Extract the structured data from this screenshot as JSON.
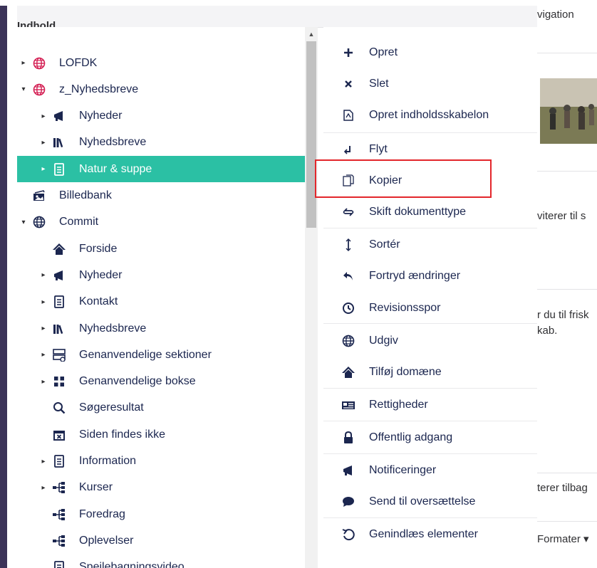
{
  "tree": {
    "header": "Indhold",
    "items": [
      {
        "label": "LOFDK",
        "icon": "globe-icon",
        "caret": "collapsed",
        "indent": 0
      },
      {
        "label": "z_Nyhedsbreve",
        "icon": "globe-icon",
        "caret": "expanded",
        "indent": 0
      },
      {
        "label": "Nyheder",
        "icon": "megaphone-icon",
        "caret": "collapsed",
        "indent": 1
      },
      {
        "label": "Nyhedsbreve",
        "icon": "library-icon",
        "caret": "collapsed",
        "indent": 1
      },
      {
        "label": "Natur & suppe",
        "icon": "document-icon",
        "caret": "collapsed",
        "indent": 1,
        "active": true
      },
      {
        "label": "Billedbank",
        "icon": "pictures-icon",
        "caret": "none",
        "indent": 0
      },
      {
        "label": "Commit",
        "icon": "globe-icon",
        "caret": "expanded",
        "indent": 0
      },
      {
        "label": "Forside",
        "icon": "home-icon",
        "caret": "none",
        "indent": 1
      },
      {
        "label": "Nyheder",
        "icon": "megaphone-icon",
        "caret": "collapsed",
        "indent": 1
      },
      {
        "label": "Kontakt",
        "icon": "document-icon",
        "caret": "collapsed",
        "indent": 1
      },
      {
        "label": "Nyhedsbreve",
        "icon": "library-icon",
        "caret": "collapsed",
        "indent": 1
      },
      {
        "label": "Genanvendelige sektioner",
        "icon": "sections-icon",
        "caret": "collapsed",
        "indent": 1
      },
      {
        "label": "Genanvendelige bokse",
        "icon": "grid-icon",
        "caret": "collapsed",
        "indent": 1
      },
      {
        "label": "Søgeresultat",
        "icon": "search-icon",
        "caret": "none",
        "indent": 1
      },
      {
        "label": "Siden findes ikke",
        "icon": "calendar-x-icon",
        "caret": "none",
        "indent": 1
      },
      {
        "label": "Information",
        "icon": "document-icon",
        "caret": "collapsed",
        "indent": 1
      },
      {
        "label": "Kurser",
        "icon": "sitemap-icon",
        "caret": "collapsed",
        "indent": 1
      },
      {
        "label": "Foredrag",
        "icon": "sitemap-icon",
        "caret": "none",
        "indent": 1
      },
      {
        "label": "Oplevelser",
        "icon": "sitemap-icon",
        "caret": "none",
        "indent": 1
      },
      {
        "label": "Spejlebagningsvideo",
        "icon": "document-icon",
        "caret": "none",
        "indent": 1
      }
    ]
  },
  "menu": {
    "items": [
      {
        "label": "Opret",
        "icon": "plus-icon"
      },
      {
        "label": "Slet",
        "icon": "delete-icon"
      },
      {
        "label": "Opret indholdsskabelon",
        "icon": "blueprint-icon"
      },
      {
        "label": "Flyt",
        "icon": "move-icon"
      },
      {
        "label": "Kopier",
        "icon": "copy-icon"
      },
      {
        "label": "Skift dokumenttype",
        "icon": "swap-icon"
      },
      {
        "label": "Sortér",
        "icon": "sort-icon"
      },
      {
        "label": "Fortryd ændringer",
        "icon": "undo-icon"
      },
      {
        "label": "Revisionsspor",
        "icon": "history-icon"
      },
      {
        "label": "Udgiv",
        "icon": "globe-icon"
      },
      {
        "label": "Tilføj domæne",
        "icon": "home-icon"
      },
      {
        "label": "Rettigheder",
        "icon": "permissions-icon"
      },
      {
        "label": "Offentlig adgang",
        "icon": "lock-icon"
      },
      {
        "label": "Notificeringer",
        "icon": "megaphone-icon"
      },
      {
        "label": "Send til oversættelse",
        "icon": "chat-icon"
      },
      {
        "label": "Genindlæs elementer",
        "icon": "reload-icon"
      }
    ]
  },
  "background": {
    "navigation_text": "vigation",
    "text1": "viterer til s",
    "text2": "r du til frisk",
    "text3": "kab.",
    "text4": "terer tilbag",
    "formater_label": "Formater ▾"
  },
  "colors": {
    "accent": "#2bc0a4",
    "text": "#1b264f",
    "highlight_box": "#e3262b",
    "globe_red": "#d42054"
  }
}
